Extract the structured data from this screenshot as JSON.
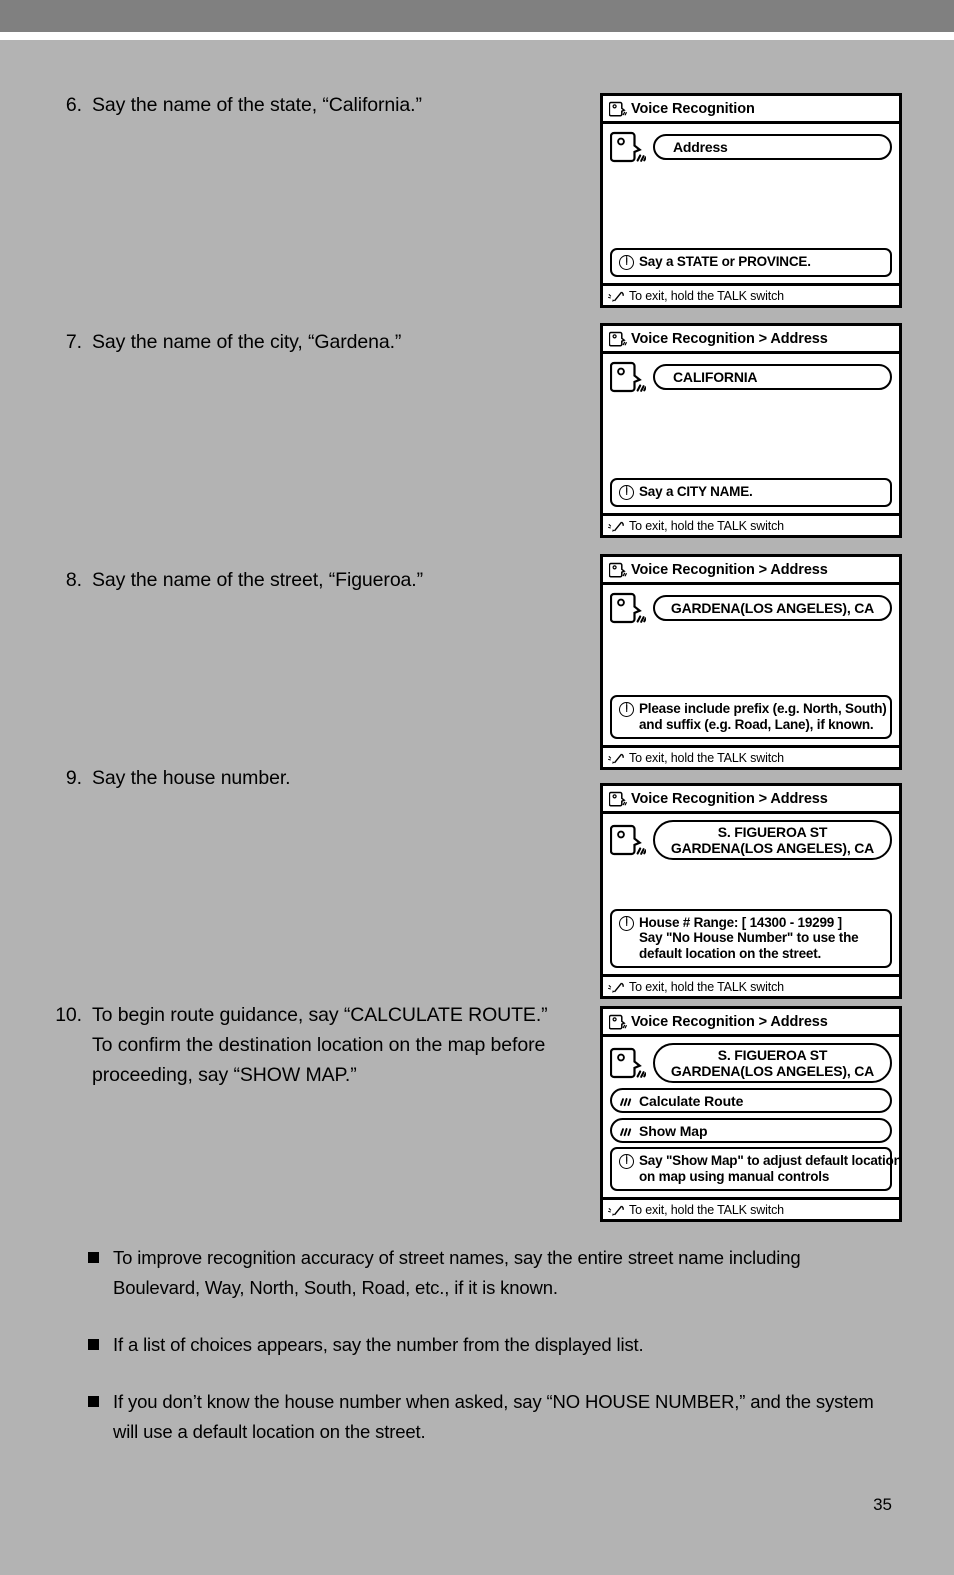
{
  "page": {
    "number": "35",
    "header_bar_color": "#808080",
    "body_color": "#b3b3b3"
  },
  "steps": [
    {
      "number": "6.",
      "text": "Say the name of the state, “California.”"
    },
    {
      "number": "7.",
      "text": "Say the name of the city, “Gardena.”"
    },
    {
      "number": "8.",
      "text": "Say the name of the street, “Figueroa.”"
    },
    {
      "number": "9.",
      "text": "Say the house number."
    },
    {
      "number": "10.",
      "text": "To begin route guidance, say “CALCULATE ROUTE.” To confirm the destination location on the map before proceeding, say “SHOW MAP.”"
    }
  ],
  "screens": [
    {
      "title": "Voice Recognition",
      "value_lines": [
        "Address"
      ],
      "value_align": "left",
      "commands": [],
      "hint_lines": [
        "Say a STATE or PROVINCE."
      ],
      "footer": "To exit, hold the TALK switch"
    },
    {
      "title": "Voice Recognition > Address",
      "value_lines": [
        "CALIFORNIA"
      ],
      "value_align": "left",
      "commands": [],
      "hint_lines": [
        "Say a CITY NAME."
      ],
      "footer": "To exit, hold the TALK switch"
    },
    {
      "title": "Voice Recognition > Address",
      "value_lines": [
        "GARDENA(LOS ANGELES), CA"
      ],
      "value_align": "center",
      "commands": [],
      "hint_lines": [
        "Please include prefix (e.g. North, South)",
        "and suffix (e.g. Road, Lane), if known."
      ],
      "footer": "To exit, hold the TALK switch"
    },
    {
      "title": "Voice Recognition > Address",
      "value_lines": [
        "S. FIGUEROA ST",
        "GARDENA(LOS ANGELES), CA"
      ],
      "value_align": "center",
      "commands": [],
      "hint_lines": [
        "House # Range: [ 14300 - 19299 ]",
        "Say \"No House Number\" to use the",
        "default location on the street."
      ],
      "footer": "To exit, hold the TALK switch"
    },
    {
      "title": "Voice Recognition > Address",
      "value_lines": [
        "S. FIGUEROA ST",
        "GARDENA(LOS ANGELES), CA"
      ],
      "value_align": "center",
      "commands": [
        "Calculate Route",
        "Show Map"
      ],
      "hint_lines": [
        "Say \"Show Map\" to adjust default location",
        "on map using manual controls"
      ],
      "footer": "To exit, hold the TALK switch"
    }
  ],
  "notes": [
    "To improve recognition accuracy of street names, say the entire street name including Boulevard, Way, North, South, Road, etc., if it is known.",
    "If a list of choices appears, say the number from the displayed list.",
    "If you don’t know the house number when asked, say “NO HOUSE NUMBER,” and the system will use a default location on the street."
  ]
}
